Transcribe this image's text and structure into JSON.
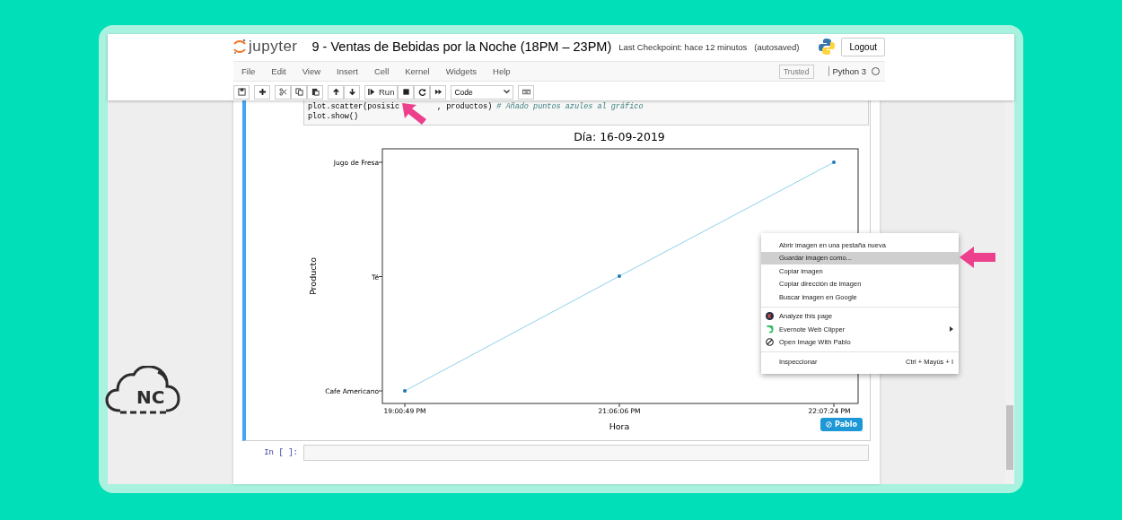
{
  "header": {
    "logo_text": "jupyter",
    "notebook_title": "9 - Ventas de Bebidas por la Noche (18PM – 23PM)",
    "checkpoint": "Last Checkpoint: hace 12 minutos",
    "autosave": "(autosaved)",
    "logout": "Logout"
  },
  "menubar": {
    "items": [
      "File",
      "Edit",
      "View",
      "Insert",
      "Cell",
      "Kernel",
      "Widgets",
      "Help"
    ],
    "trusted": "Trusted",
    "kernel_name": "Python 3",
    "kernel_busy": false
  },
  "toolbar": {
    "run_label": "Run",
    "cell_type": "Code"
  },
  "cell": {
    "selected": true,
    "code_lines": [
      {
        "code": "plot.scatter(posisic",
        "code_after": ", productos)",
        "comment": "# Añado puntos azules al gráfico"
      },
      {
        "code": "plot.show()"
      }
    ],
    "chart": {
      "title": "Día: 16-09-2019",
      "xlabel": "Hora",
      "ylabel": "Producto",
      "x_labels": [
        "19:00:49 PM",
        "21:06:06 PM",
        "22:07:24 PM"
      ],
      "y_labels": [
        "Jugo de Fresa",
        "Té",
        "Cafe Americano"
      ]
    },
    "pablo_button": "Pablo"
  },
  "empty_cell": {
    "prompt": "In [ ]:"
  },
  "context_menu": {
    "groups": [
      [
        {
          "label": "Abrir imagen en una pestaña nueva",
          "selected": false
        },
        {
          "label": "Guardar imagen como...",
          "selected": true
        },
        {
          "label": "Copiar imagen",
          "selected": false
        },
        {
          "label": "Copiar dirección de imagen",
          "selected": false
        },
        {
          "label": "Buscar imagen en Google",
          "selected": false
        }
      ],
      [
        {
          "label": "Analyze this page",
          "kind": "extension-k",
          "selected": false
        },
        {
          "label": "Evernote Web Clipper",
          "kind": "extension-evernote",
          "submenu": true,
          "selected": false
        },
        {
          "label": "Open Image With Pablo",
          "kind": "extension-pablo",
          "selected": false
        }
      ],
      [
        {
          "label": "Inspeccionar",
          "shortcut": "Ctrl + Mayús + I",
          "selected": false
        }
      ]
    ]
  },
  "watermark_logo": {
    "text": "NC"
  }
}
